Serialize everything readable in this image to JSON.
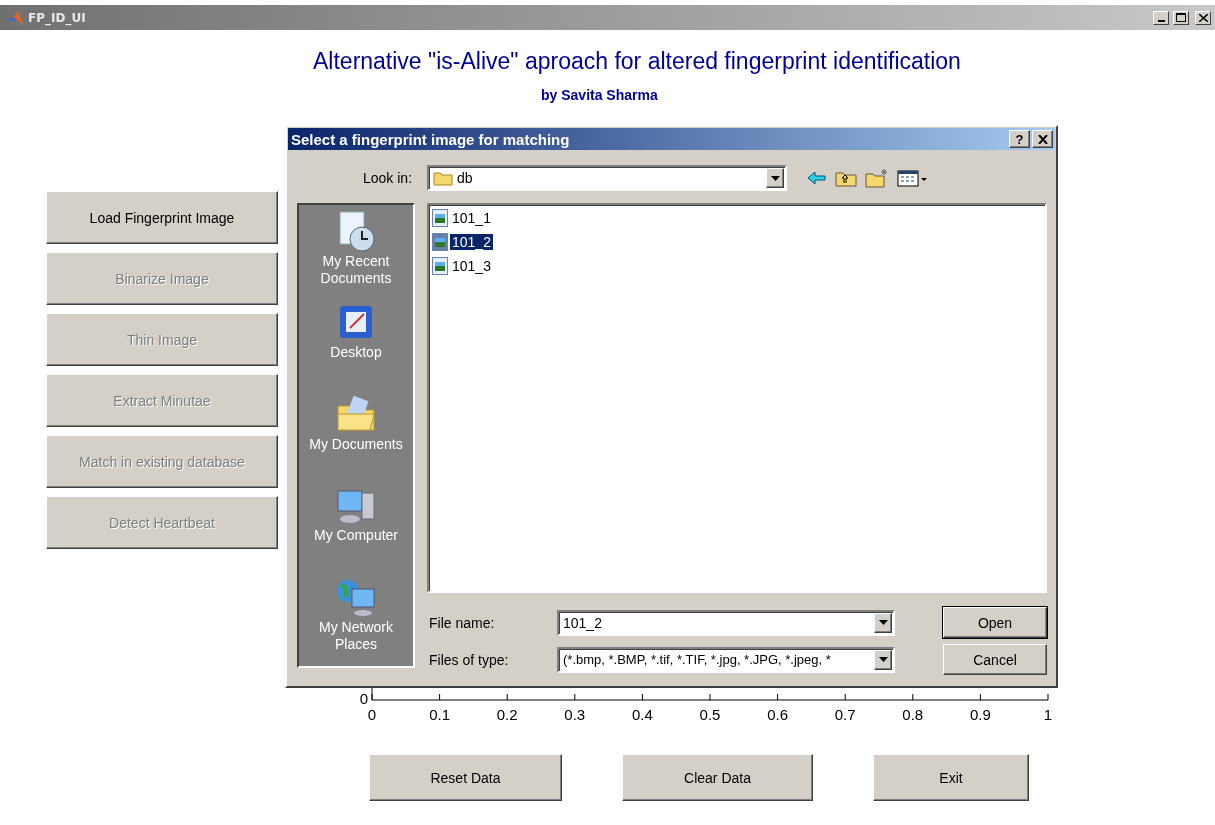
{
  "window": {
    "title": "FP_ID_UI"
  },
  "header": {
    "title": "Alternative \"is-Alive\" aproach for altered fingerprint identification",
    "byline": "by Savita Sharma"
  },
  "side_buttons": [
    {
      "label": "Load Fingerprint Image",
      "disabled": false
    },
    {
      "label": "Binarize Image",
      "disabled": true
    },
    {
      "label": "Thin Image",
      "disabled": true
    },
    {
      "label": "Extract Minutae",
      "disabled": true
    },
    {
      "label": "Match in existing database",
      "disabled": true
    },
    {
      "label": "Detect Heartbeat",
      "disabled": true
    }
  ],
  "axes": {
    "yticks": [
      "0"
    ],
    "xticks": [
      "0",
      "0.1",
      "0.2",
      "0.3",
      "0.4",
      "0.5",
      "0.6",
      "0.7",
      "0.8",
      "0.9",
      "1"
    ]
  },
  "bottom_buttons": [
    "Reset Data",
    "Clear Data",
    "Exit"
  ],
  "dialog": {
    "title": "Select a fingerprint image for matching",
    "help": "?",
    "look_in": {
      "label": "Look in:",
      "value": "db"
    },
    "places": [
      {
        "label": "My Recent Documents",
        "kind": "recent"
      },
      {
        "label": "Desktop",
        "kind": "desktop"
      },
      {
        "label": "My Documents",
        "kind": "documents"
      },
      {
        "label": "My Computer",
        "kind": "computer"
      },
      {
        "label": "My Network Places",
        "kind": "network"
      }
    ],
    "files": [
      {
        "name": "101_1",
        "selected": false
      },
      {
        "name": "101_2",
        "selected": true
      },
      {
        "name": "101_3",
        "selected": false
      }
    ],
    "file_name": {
      "label": "File name:",
      "value": "101_2"
    },
    "file_type": {
      "label": "Files of type:",
      "value": "(*.bmp, *.BMP, *.tif, *.TIF, *.jpg, *.JPG, *.jpeg, *"
    },
    "buttons": [
      "Open",
      "Cancel"
    ]
  }
}
